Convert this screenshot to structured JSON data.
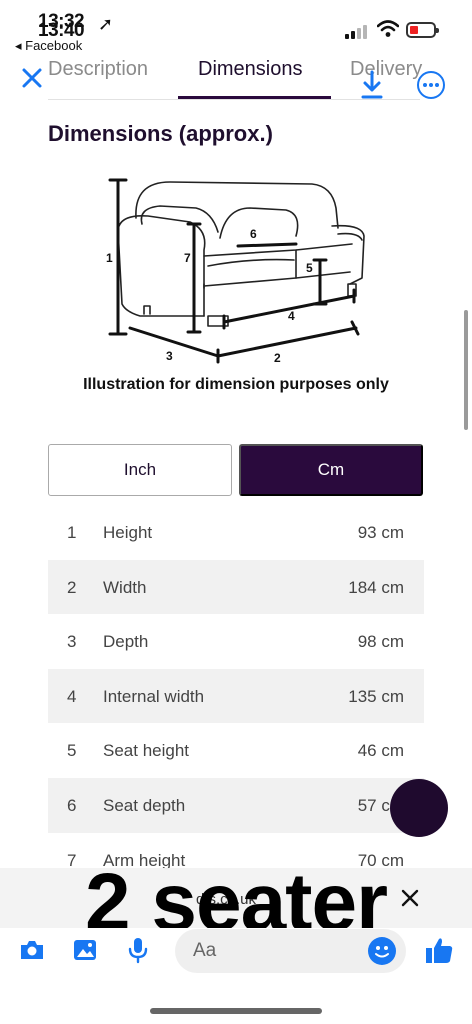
{
  "status_bar": {
    "time_back": "13:32",
    "time_front": "13:40",
    "back_app": "◂ Facebook"
  },
  "tabs": [
    {
      "label": "Description",
      "active": false
    },
    {
      "label": "Dimensions",
      "active": true
    },
    {
      "label": "Delivery",
      "active": false
    }
  ],
  "page_title": "Dimensions (approx.)",
  "illustration": {
    "caption": "Illustration for dimension purposes only",
    "markers": [
      "1",
      "2",
      "3",
      "4",
      "5",
      "6",
      "7"
    ]
  },
  "units": {
    "inch": "Inch",
    "cm": "Cm",
    "selected": "cm"
  },
  "dimensions": [
    {
      "num": "1",
      "label": "Height",
      "value": "93 cm"
    },
    {
      "num": "2",
      "label": "Width",
      "value": "184 cm"
    },
    {
      "num": "3",
      "label": "Depth",
      "value": "98 cm"
    },
    {
      "num": "4",
      "label": "Internal width",
      "value": "135 cm"
    },
    {
      "num": "5",
      "label": "Seat height",
      "value": "46 cm"
    },
    {
      "num": "6",
      "label": "Seat depth",
      "value": "57 cm"
    },
    {
      "num": "7",
      "label": "Arm height",
      "value": "70 cm"
    }
  ],
  "url_bar": {
    "text": "dfs.co.uk"
  },
  "overlay_caption": "2 seater",
  "composer": {
    "placeholder": "Aa"
  },
  "colors": {
    "brand": "#2a0a3d",
    "accent": "#1877f2",
    "row_shade": "#f1f1f1"
  }
}
